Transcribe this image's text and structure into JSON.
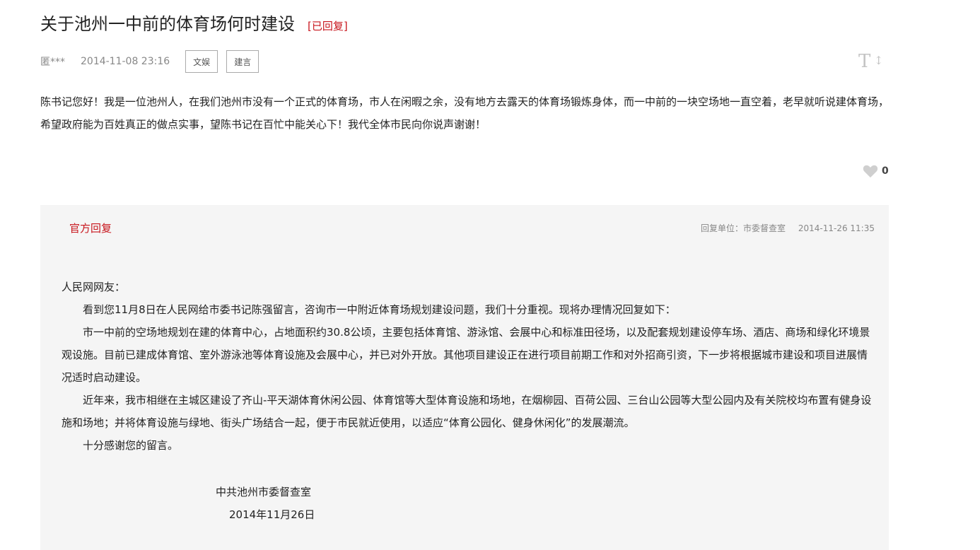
{
  "question": {
    "title": "关于池州一中前的体育场何时建设",
    "status": "[已回复]",
    "author": "匿***",
    "datetime": "2014-11-08 23:16",
    "tags": [
      "文娱",
      "建言"
    ],
    "font_toggle": "T",
    "body": "陈书记您好！我是一位池州人，在我们池州市没有一个正式的体育场，市人在闲暇之余，没有地方去露天的体育场锻炼身体，而一中前的一块空场地一直空着，老早就听说建体育场，希望政府能为百姓真正的做点实事，望陈书记在百忙中能关心下！我代全体市民向你说声谢谢！",
    "like_count": "0"
  },
  "reply": {
    "label": "官方回复",
    "unit": "回复单位：市委督查室",
    "datetime": "2014-11-26 11:35",
    "greeting": "人民网网友：",
    "paragraphs": [
      "看到您11月8日在人民网给市委书记陈强留言，咨询市一中附近体育场规划建设问题，我们十分重视。现将办理情况回复如下：",
      "市一中前的空场地规划在建的体育中心，占地面积约30.8公顷，主要包括体育馆、游泳馆、会展中心和标准田径场，以及配套规划建设停车场、酒店、商场和绿化环境景观设施。目前已建成体育馆、室外游泳池等体育设施及会展中心，并已对外开放。其他项目建设正在进行项目前期工作和对外招商引资，下一步将根据城市建设和项目进展情况适时启动建设。",
      "近年来，我市相继在主城区建设了齐山-平天湖体育休闲公园、体育馆等大型体育设施和场地，在烟柳园、百荷公园、三台山公园等大型公园内及有关院校均布置有健身设施和场地；并将体育设施与绿地、街头广场结合一起，便于市民就近使用，以适应“体育公园化、健身休闲化”的发展潮流。",
      "十分感谢您的留言。"
    ],
    "signature": "中共池州市委督查室",
    "sign_date": "2014年11月26日"
  },
  "colors": {
    "accent": "#c8161d",
    "reply_bg": "#f5f5f5"
  },
  "icons": {
    "font_size": "font-size-icon",
    "like": "heart-icon"
  }
}
